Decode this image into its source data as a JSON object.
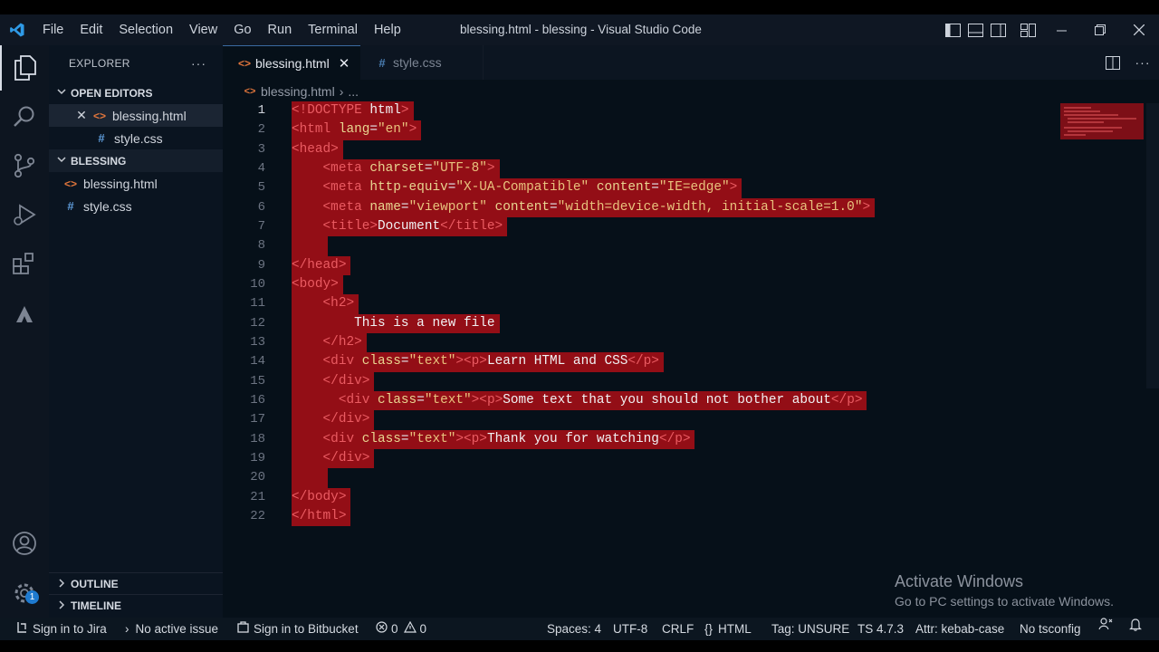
{
  "window": {
    "title": "blessing.html - blessing - Visual Studio Code",
    "menu": [
      "File",
      "Edit",
      "Selection",
      "View",
      "Go",
      "Run",
      "Terminal",
      "Help"
    ]
  },
  "explorer": {
    "header": "EXPLORER",
    "more": "···",
    "open_editors": {
      "title": "OPEN EDITORS",
      "items": [
        {
          "name": "blessing.html",
          "type": "html"
        },
        {
          "name": "style.css",
          "type": "css"
        }
      ]
    },
    "folder": {
      "title": "BLESSING",
      "items": [
        {
          "name": "blessing.html",
          "type": "html"
        },
        {
          "name": "style.css",
          "type": "css"
        }
      ]
    },
    "outline": "OUTLINE",
    "timeline": "TIMELINE"
  },
  "tabs": [
    {
      "label": "blessing.html",
      "active": true
    },
    {
      "label": "style.css",
      "active": false
    }
  ],
  "breadcrumb": {
    "file": "blessing.html",
    "rest": "..."
  },
  "settings_badge": "1",
  "code_lines": [
    "1",
    "2",
    "3",
    "4",
    "5",
    "6",
    "7",
    "8",
    "9",
    "10",
    "11",
    "12",
    "13",
    "14",
    "15",
    "16",
    "17",
    "18",
    "19",
    "20",
    "21",
    "22"
  ],
  "watermark": {
    "title": "Activate Windows",
    "subtitle": "Go to PC settings to activate Windows."
  },
  "status": {
    "jira": "Sign in to Jira",
    "issue": "No active issue",
    "bitbucket": "Sign in to Bitbucket",
    "errors": "0",
    "warnings": "0",
    "spaces": "Spaces: 4",
    "encoding": "UTF-8",
    "eol": "CRLF",
    "language": "HTML",
    "tag": "Tag: UNSURE",
    "ts": "TS 4.7.3",
    "attr": "Attr: kebab-case",
    "tsconfig": "No tsconfig"
  },
  "colors": {
    "selection": "#930e16",
    "tag": "#ea5b62",
    "attribute": "#e8d590",
    "string": "#e8c27d",
    "html_icon": "#e2763c",
    "css_icon": "#5d9ad8"
  }
}
